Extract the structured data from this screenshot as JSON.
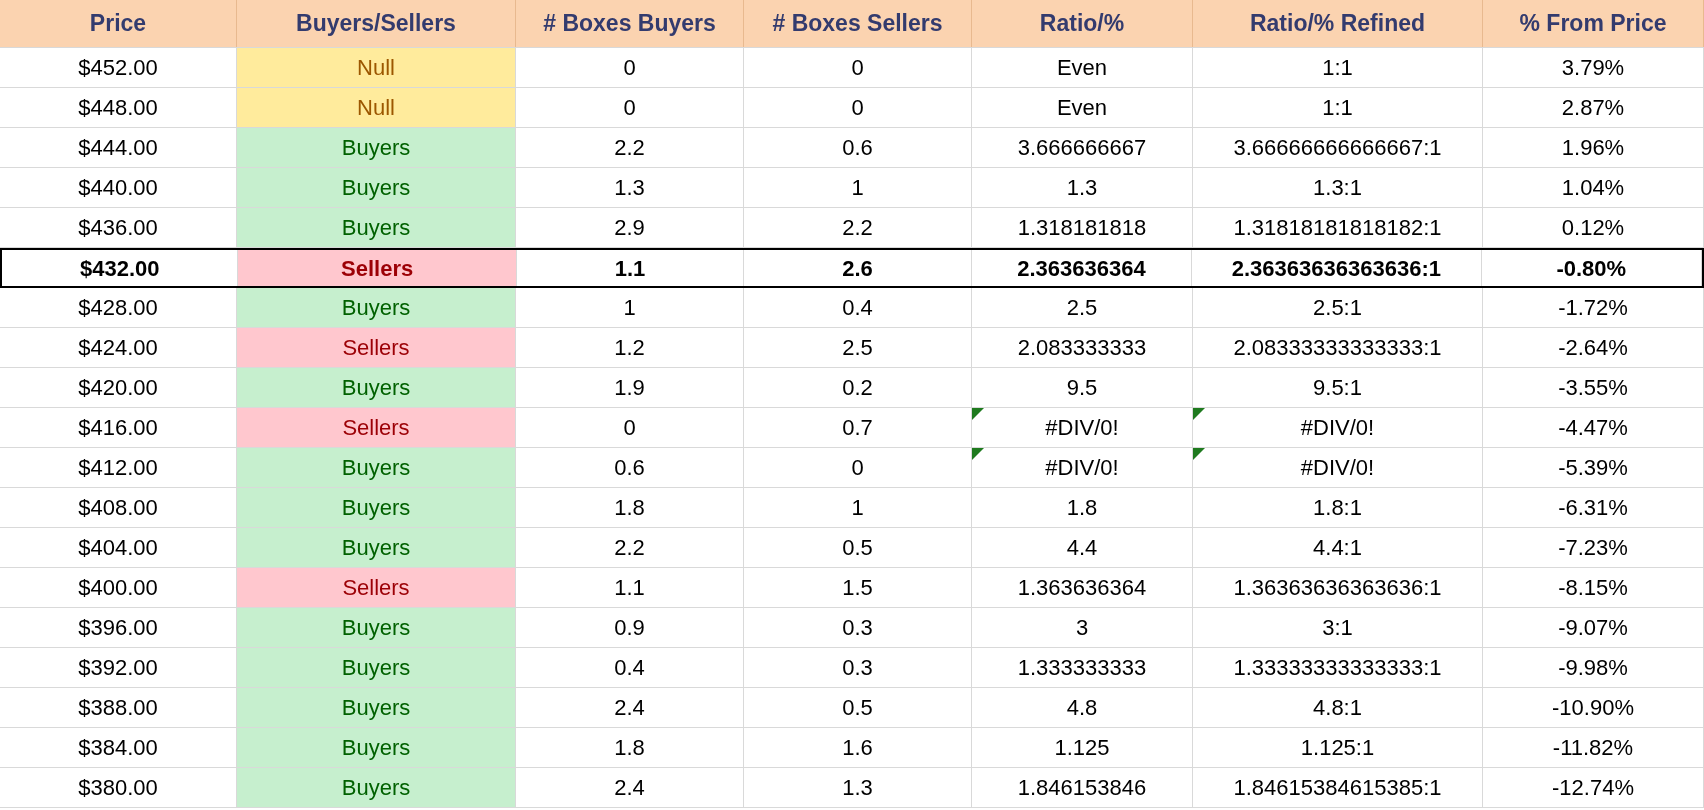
{
  "table": {
    "columns": [
      "Price",
      "Buyers/Sellers",
      "# Boxes Buyers",
      "# Boxes Sellers",
      "Ratio/%",
      "Ratio/% Refined",
      "% From Price"
    ],
    "rows": [
      {
        "price": "$452.00",
        "side": {
          "text": "Null",
          "kind": "null"
        },
        "boxes_buyers": "0",
        "boxes_sellers": "0",
        "ratio": {
          "text": "Even",
          "flagged": false
        },
        "refined": {
          "text": "1:1",
          "flagged": false
        },
        "from_price": "3.79%",
        "highlighted": false
      },
      {
        "price": "$448.00",
        "side": {
          "text": "Null",
          "kind": "null"
        },
        "boxes_buyers": "0",
        "boxes_sellers": "0",
        "ratio": {
          "text": "Even",
          "flagged": false
        },
        "refined": {
          "text": "1:1",
          "flagged": false
        },
        "from_price": "2.87%",
        "highlighted": false
      },
      {
        "price": "$444.00",
        "side": {
          "text": "Buyers",
          "kind": "buyers"
        },
        "boxes_buyers": "2.2",
        "boxes_sellers": "0.6",
        "ratio": {
          "text": "3.666666667",
          "flagged": false
        },
        "refined": {
          "text": "3.66666666666667:1",
          "flagged": false
        },
        "from_price": "1.96%",
        "highlighted": false
      },
      {
        "price": "$440.00",
        "side": {
          "text": "Buyers",
          "kind": "buyers"
        },
        "boxes_buyers": "1.3",
        "boxes_sellers": "1",
        "ratio": {
          "text": "1.3",
          "flagged": false
        },
        "refined": {
          "text": "1.3:1",
          "flagged": false
        },
        "from_price": "1.04%",
        "highlighted": false
      },
      {
        "price": "$436.00",
        "side": {
          "text": "Buyers",
          "kind": "buyers"
        },
        "boxes_buyers": "2.9",
        "boxes_sellers": "2.2",
        "ratio": {
          "text": "1.318181818",
          "flagged": false
        },
        "refined": {
          "text": "1.31818181818182:1",
          "flagged": false
        },
        "from_price": "0.12%",
        "highlighted": false
      },
      {
        "price": "$432.00",
        "side": {
          "text": "Sellers",
          "kind": "sellers"
        },
        "boxes_buyers": "1.1",
        "boxes_sellers": "2.6",
        "ratio": {
          "text": "2.363636364",
          "flagged": false
        },
        "refined": {
          "text": "2.36363636363636:1",
          "flagged": false
        },
        "from_price": "-0.80%",
        "highlighted": true
      },
      {
        "price": "$428.00",
        "side": {
          "text": "Buyers",
          "kind": "buyers"
        },
        "boxes_buyers": "1",
        "boxes_sellers": "0.4",
        "ratio": {
          "text": "2.5",
          "flagged": false
        },
        "refined": {
          "text": "2.5:1",
          "flagged": false
        },
        "from_price": "-1.72%",
        "highlighted": false
      },
      {
        "price": "$424.00",
        "side": {
          "text": "Sellers",
          "kind": "sellers"
        },
        "boxes_buyers": "1.2",
        "boxes_sellers": "2.5",
        "ratio": {
          "text": "2.083333333",
          "flagged": false
        },
        "refined": {
          "text": "2.08333333333333:1",
          "flagged": false
        },
        "from_price": "-2.64%",
        "highlighted": false
      },
      {
        "price": "$420.00",
        "side": {
          "text": "Buyers",
          "kind": "buyers"
        },
        "boxes_buyers": "1.9",
        "boxes_sellers": "0.2",
        "ratio": {
          "text": "9.5",
          "flagged": false
        },
        "refined": {
          "text": "9.5:1",
          "flagged": false
        },
        "from_price": "-3.55%",
        "highlighted": false
      },
      {
        "price": "$416.00",
        "side": {
          "text": "Sellers",
          "kind": "sellers"
        },
        "boxes_buyers": "0",
        "boxes_sellers": "0.7",
        "ratio": {
          "text": "#DIV/0!",
          "flagged": true
        },
        "refined": {
          "text": "#DIV/0!",
          "flagged": true
        },
        "from_price": "-4.47%",
        "highlighted": false
      },
      {
        "price": "$412.00",
        "side": {
          "text": "Buyers",
          "kind": "buyers"
        },
        "boxes_buyers": "0.6",
        "boxes_sellers": "0",
        "ratio": {
          "text": "#DIV/0!",
          "flagged": true
        },
        "refined": {
          "text": "#DIV/0!",
          "flagged": true
        },
        "from_price": "-5.39%",
        "highlighted": false
      },
      {
        "price": "$408.00",
        "side": {
          "text": "Buyers",
          "kind": "buyers"
        },
        "boxes_buyers": "1.8",
        "boxes_sellers": "1",
        "ratio": {
          "text": "1.8",
          "flagged": false
        },
        "refined": {
          "text": "1.8:1",
          "flagged": false
        },
        "from_price": "-6.31%",
        "highlighted": false
      },
      {
        "price": "$404.00",
        "side": {
          "text": "Buyers",
          "kind": "buyers"
        },
        "boxes_buyers": "2.2",
        "boxes_sellers": "0.5",
        "ratio": {
          "text": "4.4",
          "flagged": false
        },
        "refined": {
          "text": "4.4:1",
          "flagged": false
        },
        "from_price": "-7.23%",
        "highlighted": false
      },
      {
        "price": "$400.00",
        "side": {
          "text": "Sellers",
          "kind": "sellers"
        },
        "boxes_buyers": "1.1",
        "boxes_sellers": "1.5",
        "ratio": {
          "text": "1.363636364",
          "flagged": false
        },
        "refined": {
          "text": "1.36363636363636:1",
          "flagged": false
        },
        "from_price": "-8.15%",
        "highlighted": false
      },
      {
        "price": "$396.00",
        "side": {
          "text": "Buyers",
          "kind": "buyers"
        },
        "boxes_buyers": "0.9",
        "boxes_sellers": "0.3",
        "ratio": {
          "text": "3",
          "flagged": false
        },
        "refined": {
          "text": "3:1",
          "flagged": false
        },
        "from_price": "-9.07%",
        "highlighted": false
      },
      {
        "price": "$392.00",
        "side": {
          "text": "Buyers",
          "kind": "buyers"
        },
        "boxes_buyers": "0.4",
        "boxes_sellers": "0.3",
        "ratio": {
          "text": "1.333333333",
          "flagged": false
        },
        "refined": {
          "text": "1.33333333333333:1",
          "flagged": false
        },
        "from_price": "-9.98%",
        "highlighted": false
      },
      {
        "price": "$388.00",
        "side": {
          "text": "Buyers",
          "kind": "buyers"
        },
        "boxes_buyers": "2.4",
        "boxes_sellers": "0.5",
        "ratio": {
          "text": "4.8",
          "flagged": false
        },
        "refined": {
          "text": "4.8:1",
          "flagged": false
        },
        "from_price": "-10.90%",
        "highlighted": false
      },
      {
        "price": "$384.00",
        "side": {
          "text": "Buyers",
          "kind": "buyers"
        },
        "boxes_buyers": "1.8",
        "boxes_sellers": "1.6",
        "ratio": {
          "text": "1.125",
          "flagged": false
        },
        "refined": {
          "text": "1.125:1",
          "flagged": false
        },
        "from_price": "-11.82%",
        "highlighted": false
      },
      {
        "price": "$380.00",
        "side": {
          "text": "Buyers",
          "kind": "buyers"
        },
        "boxes_buyers": "2.4",
        "boxes_sellers": "1.3",
        "ratio": {
          "text": "1.846153846",
          "flagged": false
        },
        "refined": {
          "text": "1.84615384615385:1",
          "flagged": false
        },
        "from_price": "-12.74%",
        "highlighted": false
      }
    ]
  }
}
